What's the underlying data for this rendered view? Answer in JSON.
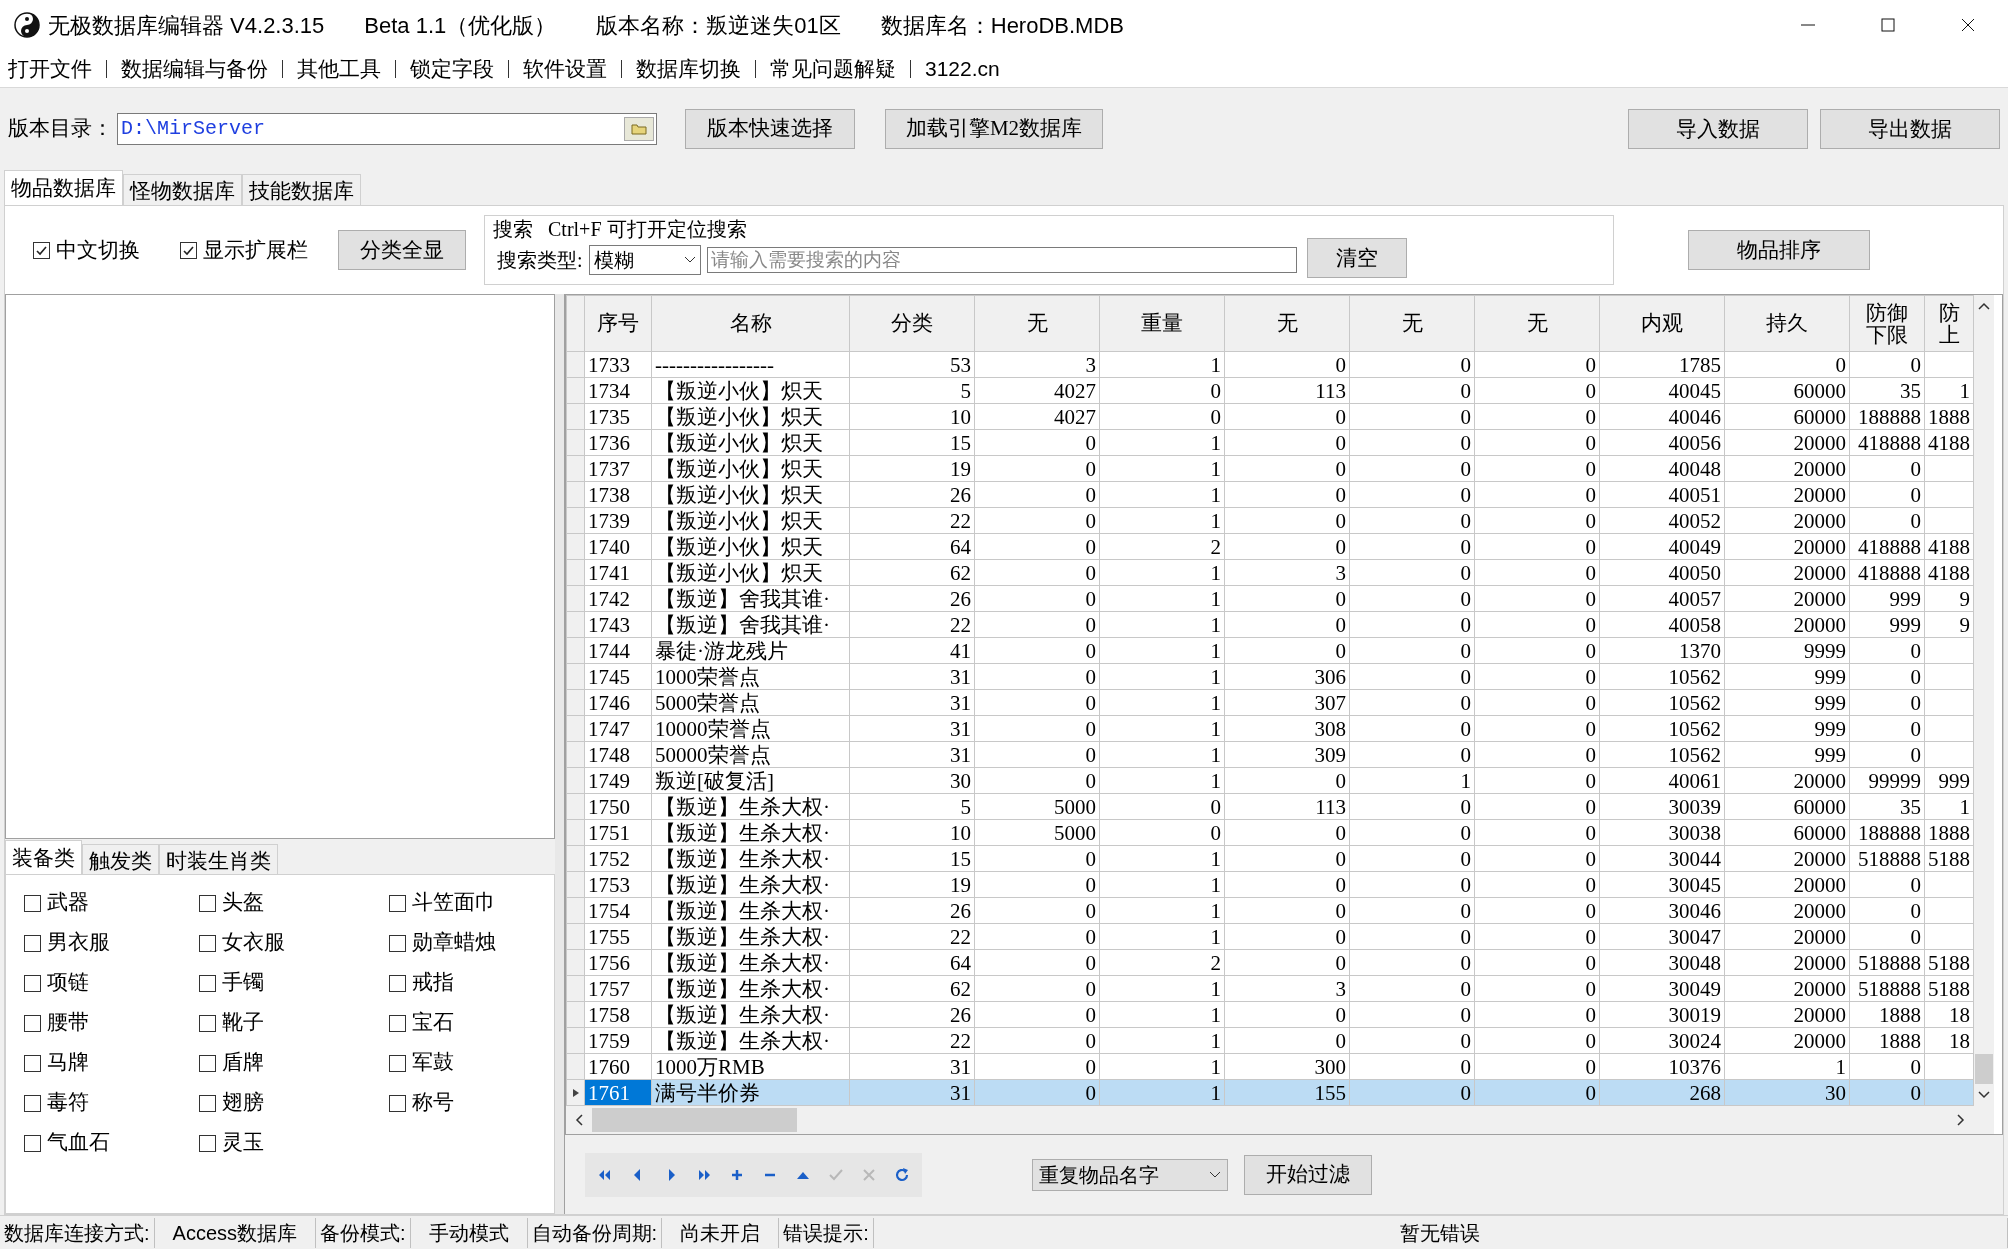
{
  "window": {
    "title_parts": [
      "无极数据库编辑器 V4.2.3.15",
      "Beta 1.1（优化版）",
      "版本名称：叛逆迷失01区",
      "数据库名：HeroDB.MDB"
    ]
  },
  "menu": [
    "打开文件",
    "数据编辑与备份",
    "其他工具",
    "锁定字段",
    "软件设置",
    "数据库切换",
    "常见问题解疑",
    "3122.cn"
  ],
  "toolbar": {
    "dir_label": "版本目录：",
    "dir_value": "D:\\MirServer",
    "buttons": [
      "版本快速选择",
      "加载引擎M2数据库"
    ],
    "right_buttons": [
      "导入数据",
      "导出数据"
    ]
  },
  "tabs": [
    {
      "label": "物品数据库",
      "selected": true
    },
    {
      "label": "怪物数据库",
      "selected": false
    },
    {
      "label": "技能数据库",
      "selected": false
    }
  ],
  "options": [
    {
      "label": "中文切换",
      "checked": true
    },
    {
      "label": "显示扩展栏",
      "checked": true
    }
  ],
  "show_all_button": "分类全显",
  "search": {
    "legend": "搜索   Ctrl+F 可打开定位搜索",
    "type_label": "搜索类型:",
    "type_value": "模糊",
    "placeholder": "请输入需要搜索的内容",
    "clear_button": "清空"
  },
  "sort_button": "物品排序",
  "category_tabs": [
    {
      "label": "装备类",
      "selected": true
    },
    {
      "label": "触发类",
      "selected": false
    },
    {
      "label": "时装生肖类",
      "selected": false
    }
  ],
  "categories": [
    {
      "label": "武器",
      "checked": false
    },
    {
      "label": "头盔",
      "checked": false
    },
    {
      "label": "斗笠面巾",
      "checked": false
    },
    {
      "label": "男衣服",
      "checked": false
    },
    {
      "label": "女衣服",
      "checked": false
    },
    {
      "label": "勋章蜡烛",
      "checked": false
    },
    {
      "label": "项链",
      "checked": false
    },
    {
      "label": "手镯",
      "checked": false
    },
    {
      "label": "戒指",
      "checked": false
    },
    {
      "label": "腰带",
      "checked": false
    },
    {
      "label": "靴子",
      "checked": false
    },
    {
      "label": "宝石",
      "checked": false
    },
    {
      "label": "马牌",
      "checked": false
    },
    {
      "label": "盾牌",
      "checked": false
    },
    {
      "label": "军鼓",
      "checked": false
    },
    {
      "label": "毒符",
      "checked": false
    },
    {
      "label": "翅膀",
      "checked": false
    },
    {
      "label": "称号",
      "checked": false
    },
    {
      "label": "气血石",
      "checked": false
    },
    {
      "label": "灵玉",
      "checked": false
    }
  ],
  "table": {
    "columns": [
      "序号",
      "名称",
      "分类",
      "无",
      "重量",
      "无",
      "无",
      "无",
      "内观",
      "持久",
      "防御下限",
      "防上"
    ],
    "rows": [
      {
        "cells": [
          "1733",
          "-----------------",
          "53",
          "3",
          "1",
          "0",
          "0",
          "0",
          "1785",
          "0",
          "0",
          ""
        ],
        "selected": false
      },
      {
        "cells": [
          "1734",
          "【叛逆小伙】炽天",
          "5",
          "4027",
          "0",
          "113",
          "0",
          "0",
          "40045",
          "60000",
          "35",
          "1"
        ],
        "selected": false
      },
      {
        "cells": [
          "1735",
          "【叛逆小伙】炽天",
          "10",
          "4027",
          "0",
          "0",
          "0",
          "0",
          "40046",
          "60000",
          "188888",
          "1888"
        ],
        "selected": false
      },
      {
        "cells": [
          "1736",
          "【叛逆小伙】炽天",
          "15",
          "0",
          "1",
          "0",
          "0",
          "0",
          "40056",
          "20000",
          "418888",
          "4188"
        ],
        "selected": false
      },
      {
        "cells": [
          "1737",
          "【叛逆小伙】炽天",
          "19",
          "0",
          "1",
          "0",
          "0",
          "0",
          "40048",
          "20000",
          "0",
          ""
        ],
        "selected": false
      },
      {
        "cells": [
          "1738",
          "【叛逆小伙】炽天",
          "26",
          "0",
          "1",
          "0",
          "0",
          "0",
          "40051",
          "20000",
          "0",
          ""
        ],
        "selected": false
      },
      {
        "cells": [
          "1739",
          "【叛逆小伙】炽天",
          "22",
          "0",
          "1",
          "0",
          "0",
          "0",
          "40052",
          "20000",
          "0",
          ""
        ],
        "selected": false
      },
      {
        "cells": [
          "1740",
          "【叛逆小伙】炽天",
          "64",
          "0",
          "2",
          "0",
          "0",
          "0",
          "40049",
          "20000",
          "418888",
          "4188"
        ],
        "selected": false
      },
      {
        "cells": [
          "1741",
          "【叛逆小伙】炽天",
          "62",
          "0",
          "1",
          "3",
          "0",
          "0",
          "40050",
          "20000",
          "418888",
          "4188"
        ],
        "selected": false
      },
      {
        "cells": [
          "1742",
          "【叛逆】舍我其谁·",
          "26",
          "0",
          "1",
          "0",
          "0",
          "0",
          "40057",
          "20000",
          "999",
          "9"
        ],
        "selected": false
      },
      {
        "cells": [
          "1743",
          "【叛逆】舍我其谁·",
          "22",
          "0",
          "1",
          "0",
          "0",
          "0",
          "40058",
          "20000",
          "999",
          "9"
        ],
        "selected": false
      },
      {
        "cells": [
          "1744",
          "暴徒·游龙残片",
          "41",
          "0",
          "1",
          "0",
          "0",
          "0",
          "1370",
          "9999",
          "0",
          ""
        ],
        "selected": false
      },
      {
        "cells": [
          "1745",
          "1000荣誉点",
          "31",
          "0",
          "1",
          "306",
          "0",
          "0",
          "10562",
          "999",
          "0",
          ""
        ],
        "selected": false
      },
      {
        "cells": [
          "1746",
          "5000荣誉点",
          "31",
          "0",
          "1",
          "307",
          "0",
          "0",
          "10562",
          "999",
          "0",
          ""
        ],
        "selected": false
      },
      {
        "cells": [
          "1747",
          "10000荣誉点",
          "31",
          "0",
          "1",
          "308",
          "0",
          "0",
          "10562",
          "999",
          "0",
          ""
        ],
        "selected": false
      },
      {
        "cells": [
          "1748",
          "50000荣誉点",
          "31",
          "0",
          "1",
          "309",
          "0",
          "0",
          "10562",
          "999",
          "0",
          ""
        ],
        "selected": false
      },
      {
        "cells": [
          "1749",
          "叛逆[破复活]",
          "30",
          "0",
          "1",
          "0",
          "1",
          "0",
          "40061",
          "20000",
          "99999",
          "999"
        ],
        "selected": false
      },
      {
        "cells": [
          "1750",
          "【叛逆】生杀大权·",
          "5",
          "5000",
          "0",
          "113",
          "0",
          "0",
          "30039",
          "60000",
          "35",
          "1"
        ],
        "selected": false
      },
      {
        "cells": [
          "1751",
          "【叛逆】生杀大权·",
          "10",
          "5000",
          "0",
          "0",
          "0",
          "0",
          "30038",
          "60000",
          "188888",
          "1888"
        ],
        "selected": false
      },
      {
        "cells": [
          "1752",
          "【叛逆】生杀大权·",
          "15",
          "0",
          "1",
          "0",
          "0",
          "0",
          "30044",
          "20000",
          "518888",
          "5188"
        ],
        "selected": false
      },
      {
        "cells": [
          "1753",
          "【叛逆】生杀大权·",
          "19",
          "0",
          "1",
          "0",
          "0",
          "0",
          "30045",
          "20000",
          "0",
          ""
        ],
        "selected": false
      },
      {
        "cells": [
          "1754",
          "【叛逆】生杀大权·",
          "26",
          "0",
          "1",
          "0",
          "0",
          "0",
          "30046",
          "20000",
          "0",
          ""
        ],
        "selected": false
      },
      {
        "cells": [
          "1755",
          "【叛逆】生杀大权·",
          "22",
          "0",
          "1",
          "0",
          "0",
          "0",
          "30047",
          "20000",
          "0",
          ""
        ],
        "selected": false
      },
      {
        "cells": [
          "1756",
          "【叛逆】生杀大权·",
          "64",
          "0",
          "2",
          "0",
          "0",
          "0",
          "30048",
          "20000",
          "518888",
          "5188"
        ],
        "selected": false
      },
      {
        "cells": [
          "1757",
          "【叛逆】生杀大权·",
          "62",
          "0",
          "1",
          "3",
          "0",
          "0",
          "30049",
          "20000",
          "518888",
          "5188"
        ],
        "selected": false
      },
      {
        "cells": [
          "1758",
          "【叛逆】生杀大权·",
          "26",
          "0",
          "1",
          "0",
          "0",
          "0",
          "30019",
          "20000",
          "1888",
          "18"
        ],
        "selected": false
      },
      {
        "cells": [
          "1759",
          "【叛逆】生杀大权·",
          "22",
          "0",
          "1",
          "0",
          "0",
          "0",
          "30024",
          "20000",
          "1888",
          "18"
        ],
        "selected": false
      },
      {
        "cells": [
          "1760",
          "1000万RMB",
          "31",
          "0",
          "1",
          "300",
          "0",
          "0",
          "10376",
          "1",
          "0",
          ""
        ],
        "selected": false
      },
      {
        "cells": [
          "1761",
          "满号半价券",
          "31",
          "0",
          "1",
          "155",
          "0",
          "0",
          "268",
          "30",
          "0",
          ""
        ],
        "selected": true
      }
    ]
  },
  "nav_buttons": [
    {
      "kind": "first",
      "disabled": false
    },
    {
      "kind": "prev",
      "disabled": false
    },
    {
      "kind": "next",
      "disabled": false
    },
    {
      "kind": "last",
      "disabled": false
    },
    {
      "kind": "add",
      "disabled": false
    },
    {
      "kind": "delete",
      "disabled": false
    },
    {
      "kind": "up",
      "disabled": false
    },
    {
      "kind": "post",
      "disabled": true
    },
    {
      "kind": "cancel",
      "disabled": true
    },
    {
      "kind": "refresh",
      "disabled": false
    }
  ],
  "filter": {
    "value": "重复物品名字",
    "button": "开始过滤"
  },
  "status_bar": [
    {
      "label": "数据库连接方式:",
      "value": "Access数据库"
    },
    {
      "label": "备份模式:",
      "value": "手动模式"
    },
    {
      "label": "自动备份周期:",
      "value": "尚未开启"
    },
    {
      "label": "错误提示:",
      "value": "暂无错误"
    }
  ]
}
